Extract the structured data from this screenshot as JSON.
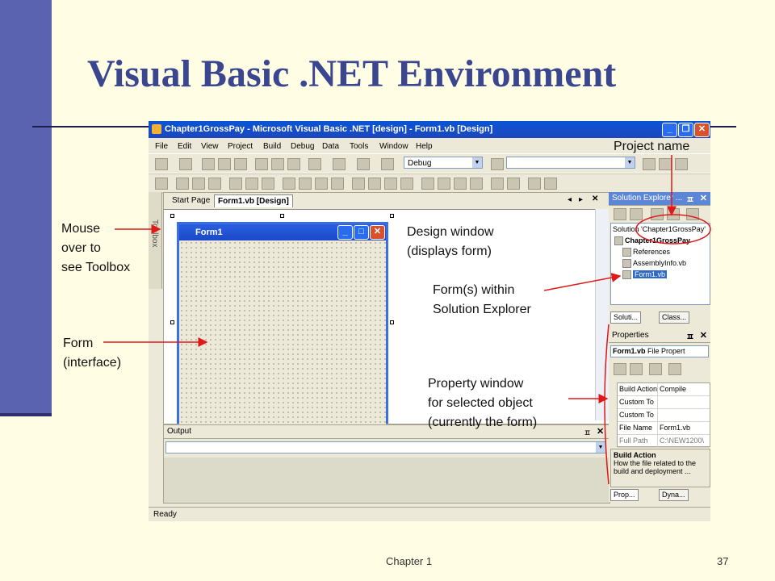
{
  "slide": {
    "title": "Visual Basic .NET Environment",
    "footer_chapter": "Chapter 1",
    "footer_page": "37"
  },
  "ide": {
    "window_title": "Chapter1GrossPay - Microsoft Visual Basic .NET [design] - Form1.vb [Design]",
    "menu": [
      "File",
      "Edit",
      "View",
      "Project",
      "Build",
      "Debug",
      "Data",
      "Tools",
      "Window",
      "Help"
    ],
    "config_combo": "Debug",
    "toolbox_label": "Toolbox",
    "doc_tabs": [
      "Start Page",
      "Form1.vb [Design]"
    ],
    "form_title": "Form1",
    "output_title": "Output",
    "status": "Ready",
    "solution_explorer": {
      "title": "Solution Explorer ...",
      "items": [
        "Solution 'Chapter1GrossPay'",
        "Chapter1GrossPay",
        "References",
        "AssemblyInfo.vb",
        "Form1.vb"
      ],
      "tabs": [
        "Soluti...",
        "Class..."
      ]
    },
    "properties": {
      "title": "Properties",
      "object": "Form1.vb",
      "object_type": "File Propert",
      "rows": [
        {
          "key": "Build Action",
          "value": "Compile"
        },
        {
          "key": "Custom To",
          "value": ""
        },
        {
          "key": "Custom To",
          "value": ""
        },
        {
          "key": "File Name",
          "value": "Form1.vb"
        },
        {
          "key": "Full Path",
          "value": "C:\\NEW1200\\"
        }
      ],
      "desc_title": "Build Action",
      "desc_text": "How the file related to the build and deployment ...",
      "tabs": [
        "Prop...",
        "Dyna..."
      ]
    }
  },
  "annotations": {
    "project_name": "Project name",
    "mouse_toolbox": [
      "Mouse",
      "over to",
      "see Toolbox"
    ],
    "design_window": [
      "Design window",
      "(displays form)"
    ],
    "form_solution": [
      "Form(s) within",
      "Solution Explorer"
    ],
    "form_interface": [
      "Form",
      "(interface)"
    ],
    "property_window": [
      "Property window",
      "for selected object",
      "(currently the form)"
    ]
  },
  "colors": {
    "slide_bg": "#fffde4",
    "slide_bar": "#5a63b0",
    "title_color": "#3b4690",
    "xp_blue": "#0a55d6",
    "arrow_red": "#e01818"
  }
}
